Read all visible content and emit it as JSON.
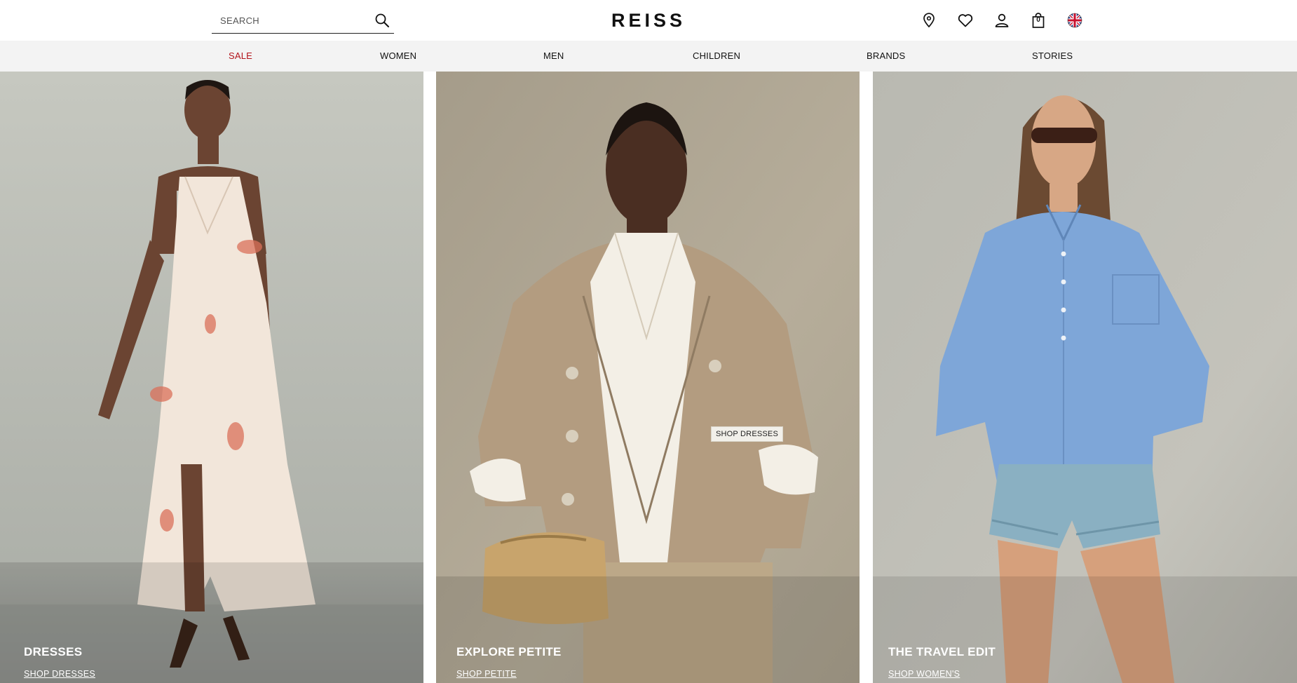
{
  "header": {
    "search": {
      "placeholder": "SEARCH",
      "value": ""
    },
    "logo": "REISS",
    "icons": [
      "store-locator-icon",
      "heart-icon",
      "account-icon",
      "bag-icon",
      "uk-flag-icon"
    ],
    "bag_count": "0"
  },
  "nav": {
    "items": [
      {
        "label": "SALE",
        "color": "#b3141b"
      },
      {
        "label": "WOMEN"
      },
      {
        "label": "MEN"
      },
      {
        "label": "CHILDREN"
      },
      {
        "label": "BRANDS"
      },
      {
        "label": "STORIES"
      }
    ]
  },
  "panels": [
    {
      "title": "DRESSES",
      "link": "SHOP DRESSES"
    },
    {
      "title": "EXPLORE PETITE",
      "link": "SHOP PETITE",
      "hotspot": "SHOP DRESSES"
    },
    {
      "title": "THE TRAVEL EDIT",
      "link": "SHOP WOMEN'S"
    }
  ],
  "colors": {
    "sale_red": "#b3141b",
    "nav_bg": "#f3f3f3"
  }
}
